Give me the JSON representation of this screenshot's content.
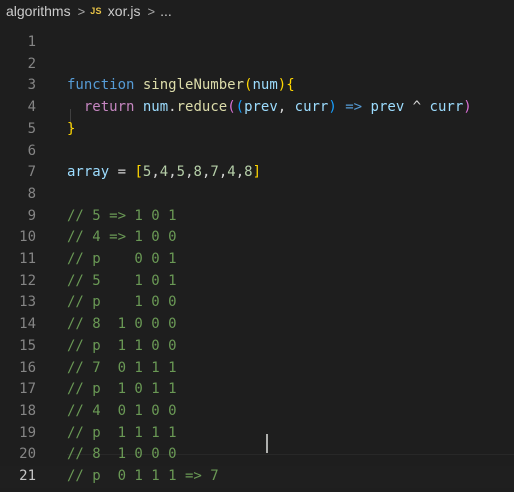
{
  "breadcrumb": {
    "folder": "algorithms",
    "file_icon": "JS",
    "file": "xor.js",
    "more": "...",
    "separator": ">"
  },
  "lines": [
    {
      "number": "1",
      "tokens": []
    },
    {
      "number": "2",
      "tokens": []
    },
    {
      "number": "3",
      "tokens": [
        {
          "t": "function",
          "c": "kw"
        },
        {
          "t": " ",
          "c": "op"
        },
        {
          "t": "singleNumber",
          "c": "fn"
        },
        {
          "t": "(",
          "c": "b1"
        },
        {
          "t": "num",
          "c": "var"
        },
        {
          "t": ")",
          "c": "b1"
        },
        {
          "t": "{",
          "c": "b1"
        }
      ]
    },
    {
      "number": "4",
      "tokens": [
        {
          "t": "  ",
          "c": "op"
        },
        {
          "t": "return",
          "c": "kw2"
        },
        {
          "t": " ",
          "c": "op"
        },
        {
          "t": "num",
          "c": "var"
        },
        {
          "t": ".",
          "c": "op"
        },
        {
          "t": "reduce",
          "c": "fn"
        },
        {
          "t": "(",
          "c": "b2"
        },
        {
          "t": "(",
          "c": "b3"
        },
        {
          "t": "prev",
          "c": "var"
        },
        {
          "t": ", ",
          "c": "op"
        },
        {
          "t": "curr",
          "c": "var"
        },
        {
          "t": ")",
          "c": "b3"
        },
        {
          "t": " ",
          "c": "op"
        },
        {
          "t": "=>",
          "c": "kw"
        },
        {
          "t": " ",
          "c": "op"
        },
        {
          "t": "prev",
          "c": "var"
        },
        {
          "t": " ^ ",
          "c": "op"
        },
        {
          "t": "curr",
          "c": "var"
        },
        {
          "t": ")",
          "c": "b2"
        }
      ]
    },
    {
      "number": "5",
      "tokens": [
        {
          "t": "}",
          "c": "b1"
        }
      ]
    },
    {
      "number": "6",
      "tokens": []
    },
    {
      "number": "7",
      "tokens": [
        {
          "t": "array",
          "c": "var"
        },
        {
          "t": " = ",
          "c": "op"
        },
        {
          "t": "[",
          "c": "b1"
        },
        {
          "t": "5",
          "c": "num"
        },
        {
          "t": ",",
          "c": "op"
        },
        {
          "t": "4",
          "c": "num"
        },
        {
          "t": ",",
          "c": "op"
        },
        {
          "t": "5",
          "c": "num"
        },
        {
          "t": ",",
          "c": "op"
        },
        {
          "t": "8",
          "c": "num"
        },
        {
          "t": ",",
          "c": "op"
        },
        {
          "t": "7",
          "c": "num"
        },
        {
          "t": ",",
          "c": "op"
        },
        {
          "t": "4",
          "c": "num"
        },
        {
          "t": ",",
          "c": "op"
        },
        {
          "t": "8",
          "c": "num"
        },
        {
          "t": "]",
          "c": "b1"
        }
      ]
    },
    {
      "number": "8",
      "tokens": []
    },
    {
      "number": "9",
      "tokens": [
        {
          "t": "// 5 => 1 0 1",
          "c": "cm"
        }
      ]
    },
    {
      "number": "10",
      "tokens": [
        {
          "t": "// 4 => 1 0 0",
          "c": "cm"
        }
      ]
    },
    {
      "number": "11",
      "tokens": [
        {
          "t": "// p    0 0 1",
          "c": "cm"
        }
      ]
    },
    {
      "number": "12",
      "tokens": [
        {
          "t": "// 5    1 0 1",
          "c": "cm"
        }
      ]
    },
    {
      "number": "13",
      "tokens": [
        {
          "t": "// p    1 0 0",
          "c": "cm"
        }
      ]
    },
    {
      "number": "14",
      "tokens": [
        {
          "t": "// 8  1 0 0 0",
          "c": "cm"
        }
      ]
    },
    {
      "number": "15",
      "tokens": [
        {
          "t": "// p  1 1 0 0",
          "c": "cm"
        }
      ]
    },
    {
      "number": "16",
      "tokens": [
        {
          "t": "// 7  0 1 1 1",
          "c": "cm"
        }
      ]
    },
    {
      "number": "17",
      "tokens": [
        {
          "t": "// p  1 0 1 1",
          "c": "cm"
        }
      ]
    },
    {
      "number": "18",
      "tokens": [
        {
          "t": "// 4  0 1 0 0",
          "c": "cm"
        }
      ]
    },
    {
      "number": "19",
      "tokens": [
        {
          "t": "// p  1 1 1 1",
          "c": "cm"
        }
      ]
    },
    {
      "number": "20",
      "tokens": [
        {
          "t": "// 8  1 0 0 0",
          "c": "cm"
        }
      ]
    },
    {
      "number": "21",
      "tokens": [
        {
          "t": "// p  0 1 1 1 => 7",
          "c": "cm"
        }
      ]
    }
  ],
  "current_line": "21"
}
